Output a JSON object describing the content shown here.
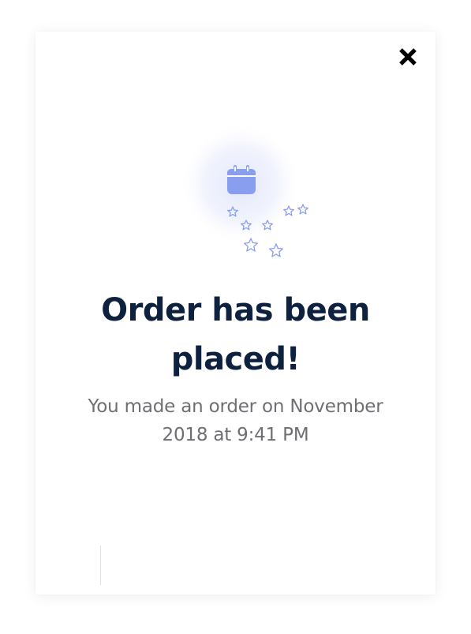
{
  "modal": {
    "title_line_1": "Order has been",
    "title_line_2": "placed!",
    "message": "You made an order on November 2018 at 9:41 PM"
  },
  "icons": {
    "close": "close-icon",
    "illustration": "calendar-icon",
    "decoration": "star-icon"
  },
  "colors": {
    "title": "#0e2240",
    "message": "#6d6f73",
    "accent": "#8a9ef0",
    "close": "#000000"
  }
}
